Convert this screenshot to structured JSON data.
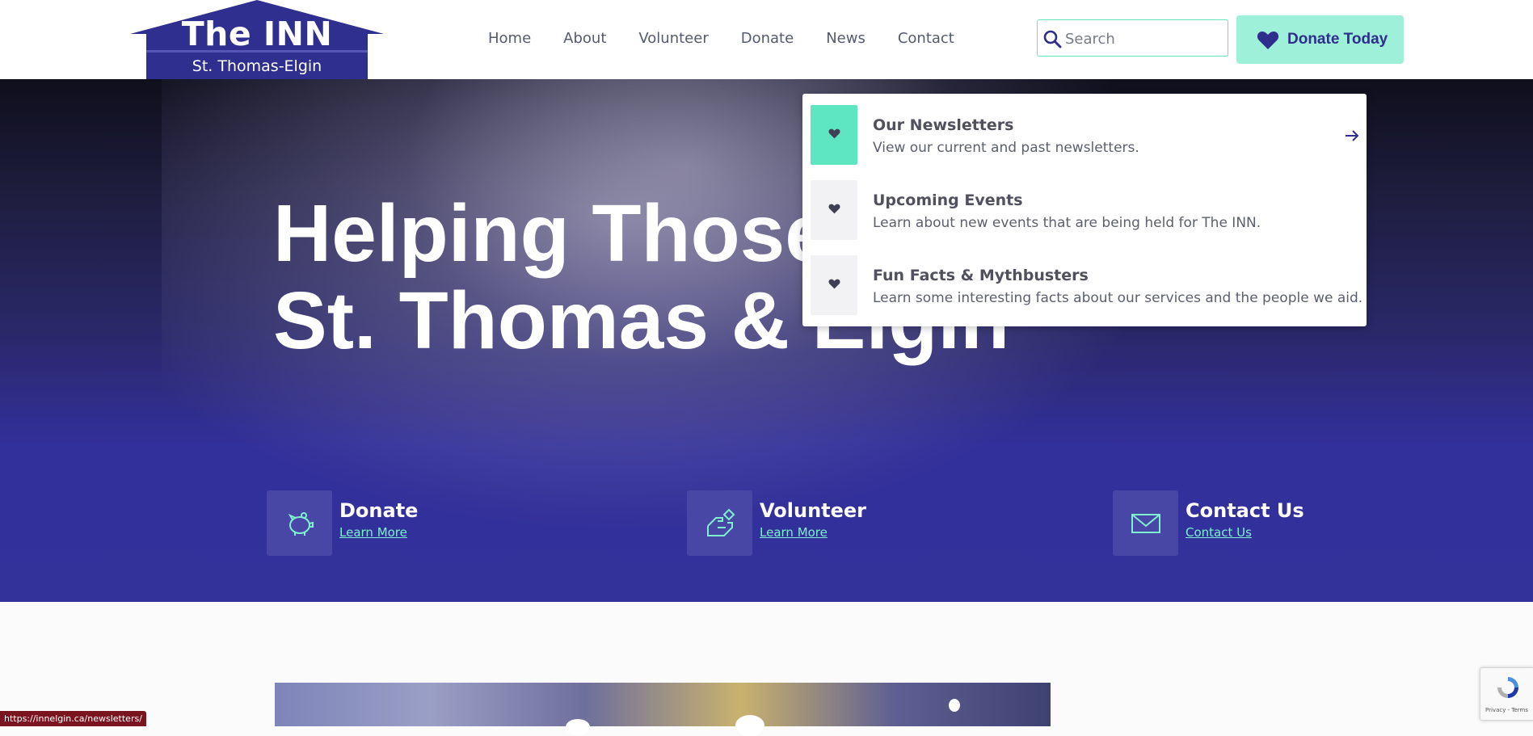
{
  "logo": {
    "title": "The INN",
    "subtitle": "St. Thomas-Elgin"
  },
  "nav": [
    "Home",
    "About",
    "Volunteer",
    "Donate",
    "News",
    "Contact"
  ],
  "search": {
    "placeholder": "Search",
    "value": ""
  },
  "donate_button": {
    "label": "Donate Today",
    "icon": "heart-icon"
  },
  "hero": {
    "title_line1": "Helping Those",
    "title_line2": "St. Thomas & Elgin"
  },
  "cta": [
    {
      "title": "Donate",
      "link": "Learn More",
      "icon": "piggy-bank-icon"
    },
    {
      "title": "Volunteer",
      "link": "Learn More",
      "icon": "helping-hand-icon"
    },
    {
      "title": "Contact Us",
      "link": "Contact Us",
      "icon": "envelope-icon"
    }
  ],
  "dropdown": [
    {
      "title": "Our Newsletters",
      "desc": "View our current and past newsletters.",
      "icon": "heart-icon"
    },
    {
      "title": "Upcoming Events",
      "desc": "Learn about new events that are being held for The INN.",
      "icon": "heart-icon"
    },
    {
      "title": "Fun Facts & Mythbusters",
      "desc": "Learn some interesting facts about our services and the people we aid.",
      "icon": "heart-icon"
    }
  ],
  "status_url": "https://innelgin.ca/newsletters/",
  "recaptcha": {
    "text": "Privacy - Terms"
  },
  "colors": {
    "brand": "#33319a",
    "accent": "#5ee6c0",
    "button": "#9ef0d8",
    "link": "#7ff0d0"
  }
}
